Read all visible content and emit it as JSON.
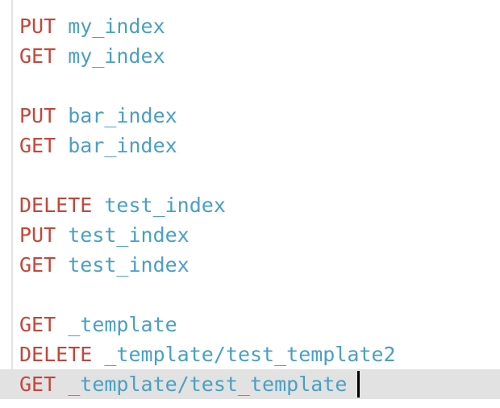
{
  "editor": {
    "lines": [
      {
        "method": "PUT",
        "path": "my_index"
      },
      {
        "method": "GET",
        "path": "my_index"
      },
      {
        "method": "",
        "path": ""
      },
      {
        "method": "PUT",
        "path": "bar_index"
      },
      {
        "method": "GET",
        "path": "bar_index"
      },
      {
        "method": "",
        "path": ""
      },
      {
        "method": "DELETE",
        "path": "test_index"
      },
      {
        "method": "PUT",
        "path": "test_index"
      },
      {
        "method": "GET",
        "path": "test_index"
      },
      {
        "method": "",
        "path": ""
      },
      {
        "method": "GET",
        "path": "_template"
      },
      {
        "method": "DELETE",
        "path": "_template/test_template2"
      },
      {
        "method": "GET",
        "path": "_template/test_template"
      }
    ],
    "active_line_index": 12
  },
  "colors": {
    "method": "#c5463a",
    "path": "#4a9fc4",
    "active_line_background": "#e2e2e2"
  }
}
